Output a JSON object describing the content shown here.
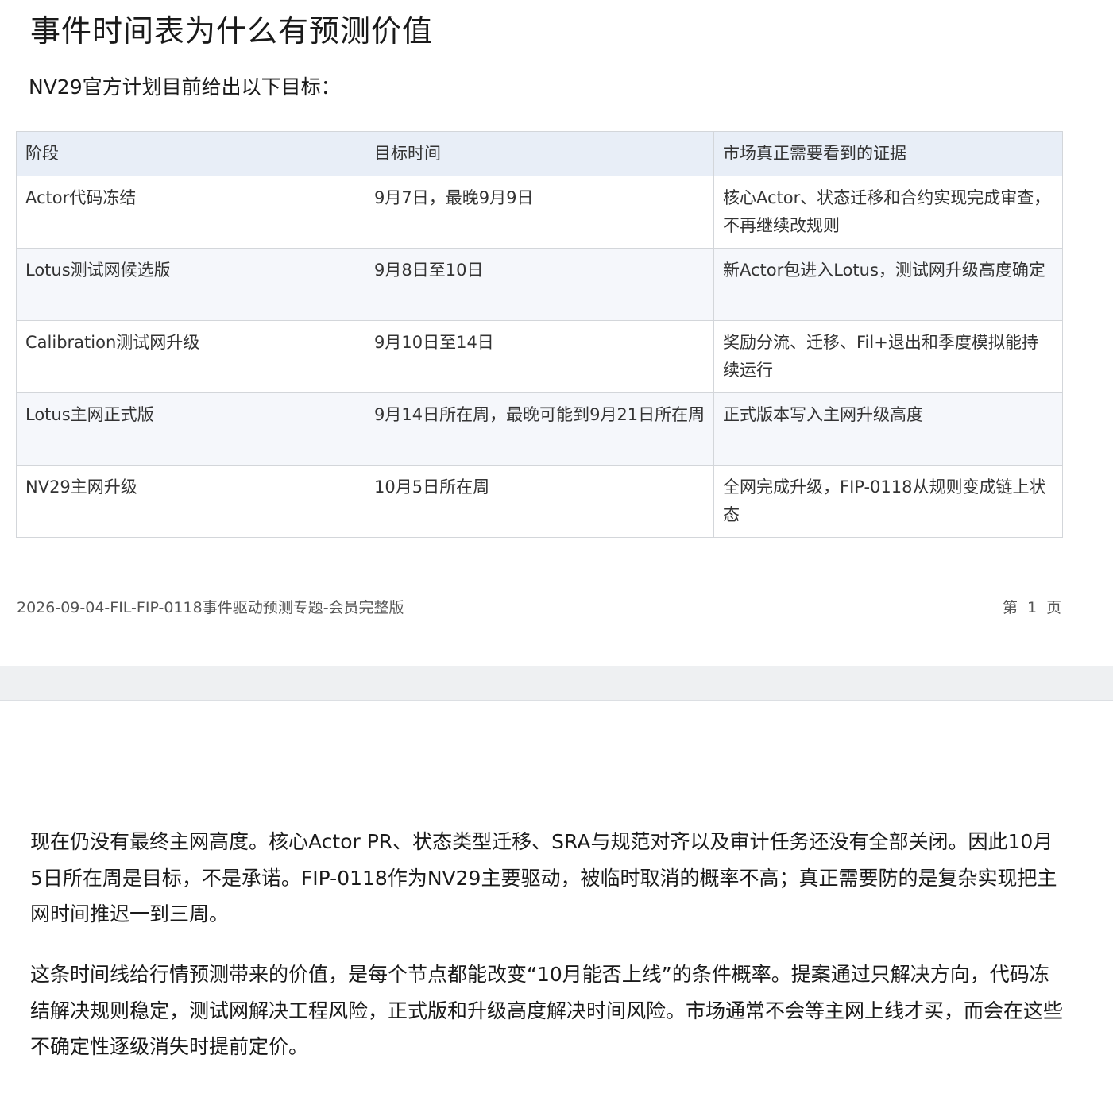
{
  "page1": {
    "title": "事件时间表为什么有预测价值",
    "intro": "NV29官方计划目前给出以下目标：",
    "table": {
      "headers": [
        "阶段",
        "目标时间",
        "市场真正需要看到的证据"
      ],
      "rows": [
        [
          "Actor代码冻结",
          "9月7日，最晚9月9日",
          "核心Actor、状态迁移和合约实现完成审查，不再继续改规则"
        ],
        [
          "Lotus测试网候选版",
          "9月8日至10日",
          "新Actor包进入Lotus，测试网升级高度确定"
        ],
        [
          "Calibration测试网升级",
          "9月10日至14日",
          "奖励分流、迁移、Fil+退出和季度模拟能持续运行"
        ],
        [
          "Lotus主网正式版",
          "9月14日所在周，最晚可能到9月21日所在周",
          "正式版本写入主网升级高度"
        ],
        [
          "NV29主网升级",
          "10月5日所在周",
          "全网完成升级，FIP-0118从规则变成链上状态"
        ]
      ]
    },
    "footer": {
      "doc_name": "2026-09-04-FIL-FIP-0118事件驱动预测专题-会员完整版",
      "page_label": "第 1 页"
    }
  },
  "page2": {
    "paragraphs": [
      "现在仍没有最终主网高度。核心Actor PR、状态类型迁移、SRA与规范对齐以及审计任务还没有全部关闭。因此10月5日所在周是目标，不是承诺。FIP-0118作为NV29主要驱动，被临时取消的概率不高；真正需要防的是复杂实现把主网时间推迟一到三周。",
      "这条时间线给行情预测带来的价值，是每个节点都能改变“10月能否上线”的条件概率。提案通过只解决方向，代码冻结解决规则稳定，测试网解决工程风险，正式版和升级高度解决时间风险。市场通常不会等主网上线才买，而会在这些不确定性逐级消失时提前定价。"
    ]
  }
}
